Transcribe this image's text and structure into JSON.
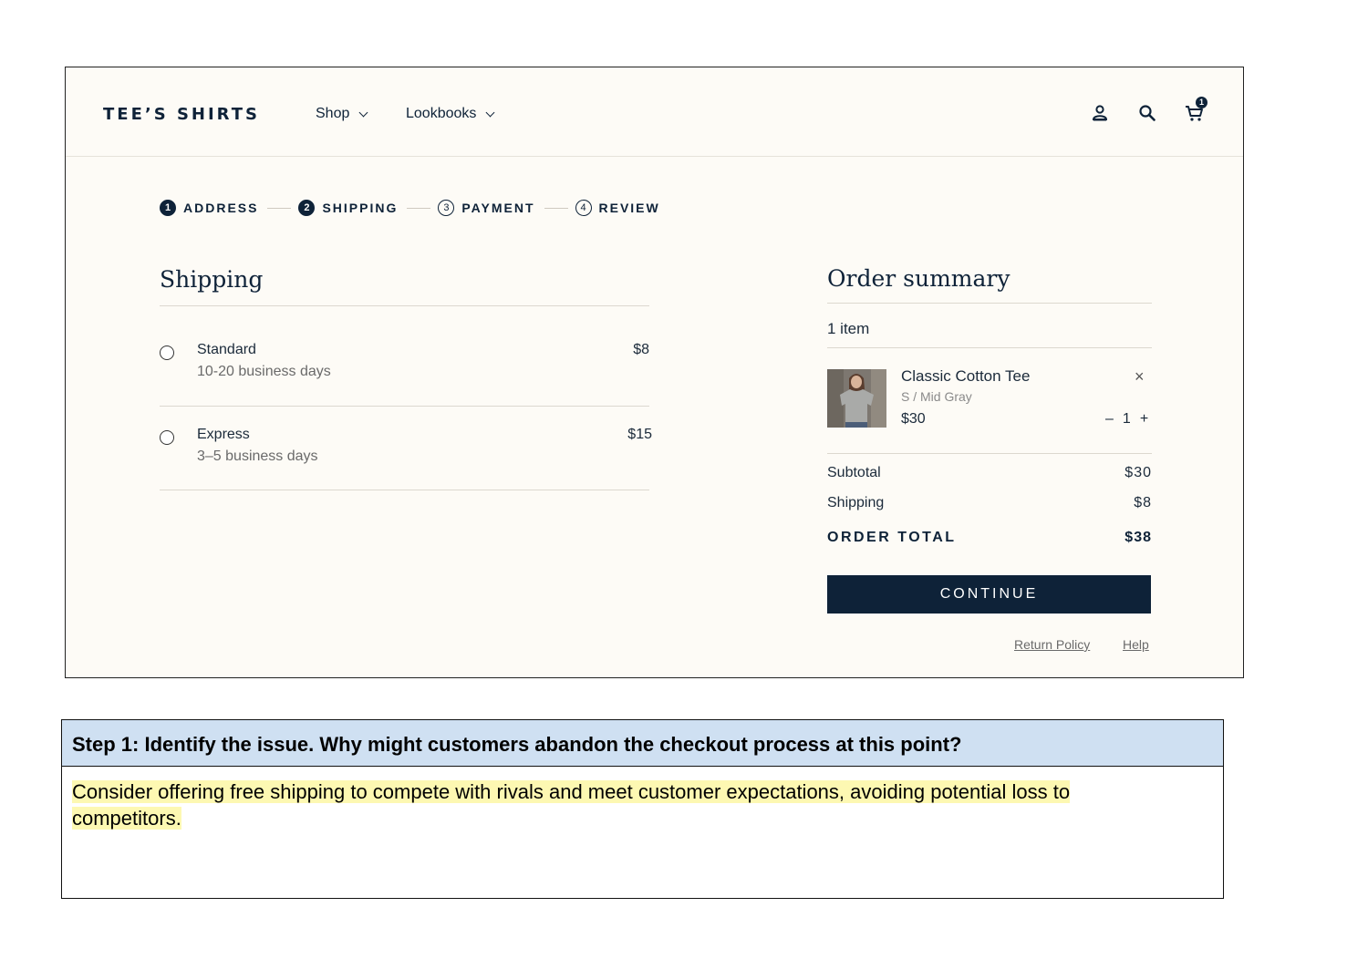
{
  "header": {
    "logo": "TEE’S SHIRTS",
    "nav": [
      {
        "label": "Shop"
      },
      {
        "label": "Lookbooks"
      }
    ],
    "cart_count": "1",
    "icons": [
      "account-icon",
      "search-icon",
      "cart-icon"
    ]
  },
  "steps": [
    {
      "num": "1",
      "label": "ADDRESS",
      "state": "complete"
    },
    {
      "num": "2",
      "label": "SHIPPING",
      "state": "current"
    },
    {
      "num": "3",
      "label": "PAYMENT",
      "state": "upcoming"
    },
    {
      "num": "4",
      "label": "REVIEW",
      "state": "upcoming"
    }
  ],
  "shipping": {
    "title": "Shipping",
    "options": [
      {
        "name": "Standard",
        "desc": "10-20 business days",
        "price": "$8",
        "selected": false
      },
      {
        "name": "Express",
        "desc": "3–5 business days",
        "price": "$15",
        "selected": false
      }
    ]
  },
  "summary": {
    "title": "Order summary",
    "item_count": "1 item",
    "item": {
      "name": "Classic Cotton Tee",
      "variant": "S  /  Mid Gray",
      "price": "$30",
      "qty": "1",
      "qty_minus": "–",
      "qty_plus": "+",
      "remove": "×"
    },
    "subtotal_label": "Subtotal",
    "subtotal": "$30",
    "shipping_label": "Shipping",
    "shipping": "$8",
    "total_label": "ORDER TOTAL",
    "total": "$38",
    "continue": "CONTINUE",
    "links": [
      "Return Policy",
      "Help"
    ]
  },
  "question": {
    "heading": "Step 1: Identify the issue. Why might customers abandon the checkout process at this point?",
    "answer": "Consider offering free shipping to compete with rivals and meet customer expectations, avoiding potential loss to competitors."
  },
  "colors": {
    "navy": "#0e2238",
    "page_bg": "#fdfbf6",
    "question_header_bg": "#cfe0f2",
    "highlight": "#fdf8b2"
  }
}
